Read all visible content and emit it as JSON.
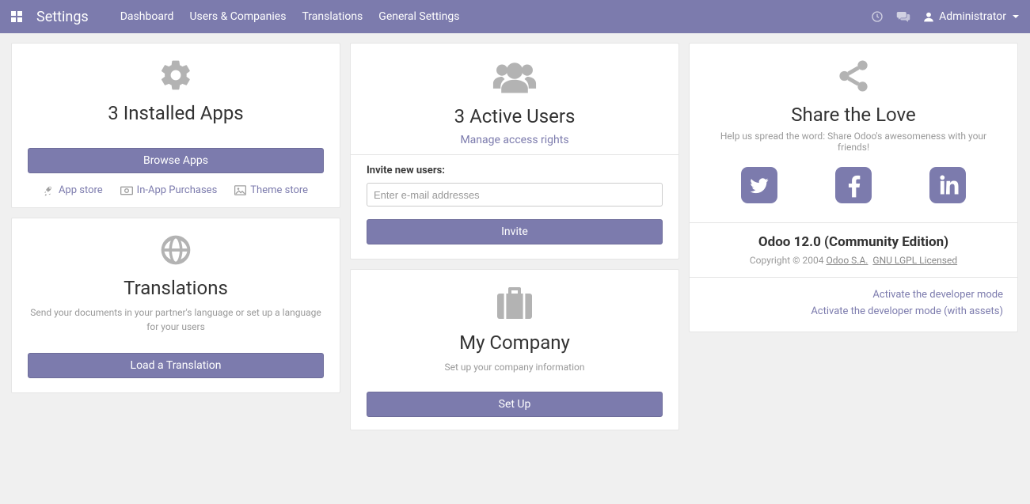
{
  "nav": {
    "title": "Settings",
    "tabs": [
      "Dashboard",
      "Users & Companies",
      "Translations",
      "General Settings"
    ],
    "user": "Administrator"
  },
  "apps_card": {
    "title": "3 Installed Apps",
    "browse": "Browse Apps",
    "links": {
      "app_store": "App store",
      "iap": "In-App Purchases",
      "theme_store": "Theme store"
    }
  },
  "translations_card": {
    "title": "Translations",
    "subtitle": "Send your documents in your partner's language or set up a language for your users",
    "button": "Load a Translation"
  },
  "users_card": {
    "title": "3 Active Users",
    "manage_link": "Manage access rights",
    "invite_label": "Invite new users:",
    "invite_placeholder": "Enter e-mail addresses",
    "invite_button": "Invite"
  },
  "company_card": {
    "title": "My Company",
    "subtitle": "Set up your company information",
    "button": "Set Up"
  },
  "share_card": {
    "title": "Share the Love",
    "subtitle": "Help us spread the word: Share Odoo's awesomeness with your friends!"
  },
  "version": {
    "title": "Odoo 12.0 (Community Edition)",
    "copyright_prefix": "Copyright © 2004 ",
    "company": "Odoo S.A.",
    "license": "GNU LGPL Licensed"
  },
  "dev": {
    "line1": "Activate the developer mode",
    "line2": "Activate the developer mode (with assets)"
  }
}
